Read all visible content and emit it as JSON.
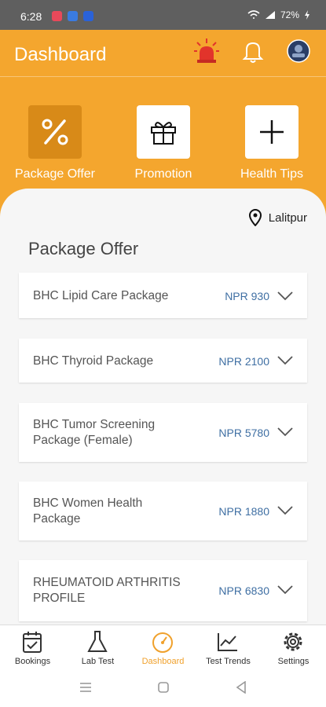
{
  "status_bar": {
    "time": "6:28",
    "battery": "72%"
  },
  "header": {
    "title": "Dashboard"
  },
  "quick_actions": [
    {
      "label": "Package Offer",
      "icon": "percent-icon",
      "active": true
    },
    {
      "label": "Promotion",
      "icon": "gift-icon",
      "active": false
    },
    {
      "label": "Health Tips",
      "icon": "plus-icon",
      "active": false
    }
  ],
  "location": {
    "label": "Lalitpur"
  },
  "section": {
    "title": "Package Offer"
  },
  "packages": [
    {
      "name": "BHC Lipid Care Package",
      "price": "NPR 930"
    },
    {
      "name": "BHC Thyroid Package",
      "price": "NPR 2100"
    },
    {
      "name": "BHC Tumor Screening Package (Female)",
      "price": "NPR 5780"
    },
    {
      "name": "BHC Women Health Package",
      "price": "NPR 1880"
    },
    {
      "name": "RHEUMATOID ARTHRITIS PROFILE",
      "price": "NPR 6830"
    }
  ],
  "bottom_nav": [
    {
      "label": "Bookings",
      "icon": "calendar-check-icon"
    },
    {
      "label": "Lab Test",
      "icon": "flask-icon"
    },
    {
      "label": "Dashboard",
      "icon": "speedometer-icon",
      "active": true
    },
    {
      "label": "Test Trends",
      "icon": "trend-chart-icon"
    },
    {
      "label": "Settings",
      "icon": "gear-icon"
    }
  ],
  "colors": {
    "brand": "#f4a62e",
    "brand_dark": "#d88a18",
    "price": "#3f6fa3"
  }
}
